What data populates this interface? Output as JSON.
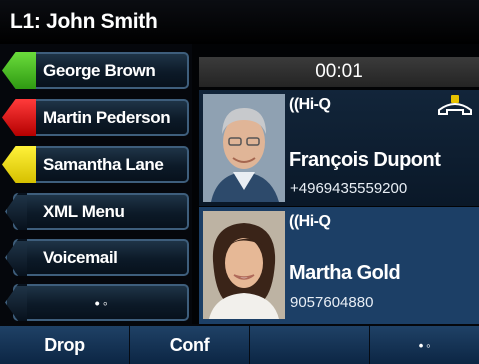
{
  "header": {
    "line_title": "L1: John Smith"
  },
  "line_keys": [
    {
      "label": "George Brown",
      "status_color": "#4cc12a"
    },
    {
      "label": "Martin Pederson",
      "status_color": "#e81212"
    },
    {
      "label": "Samantha Lane",
      "status_color": "#f3e000"
    },
    {
      "label": "XML Menu"
    },
    {
      "label": "Voicemail"
    },
    {
      "label": "• ◦"
    }
  ],
  "call_timer": "00:01",
  "calls": [
    {
      "codec": "((Hi-Q",
      "name": "François Dupont",
      "number": "+4969435559200",
      "active": true
    },
    {
      "codec": "((Hi-Q",
      "name": "Martha Gold",
      "number": "9057604880",
      "active": false
    }
  ],
  "softkeys": [
    {
      "label": "Drop"
    },
    {
      "label": "Conf"
    },
    {
      "label": ""
    },
    {
      "label": "• ◦"
    }
  ]
}
